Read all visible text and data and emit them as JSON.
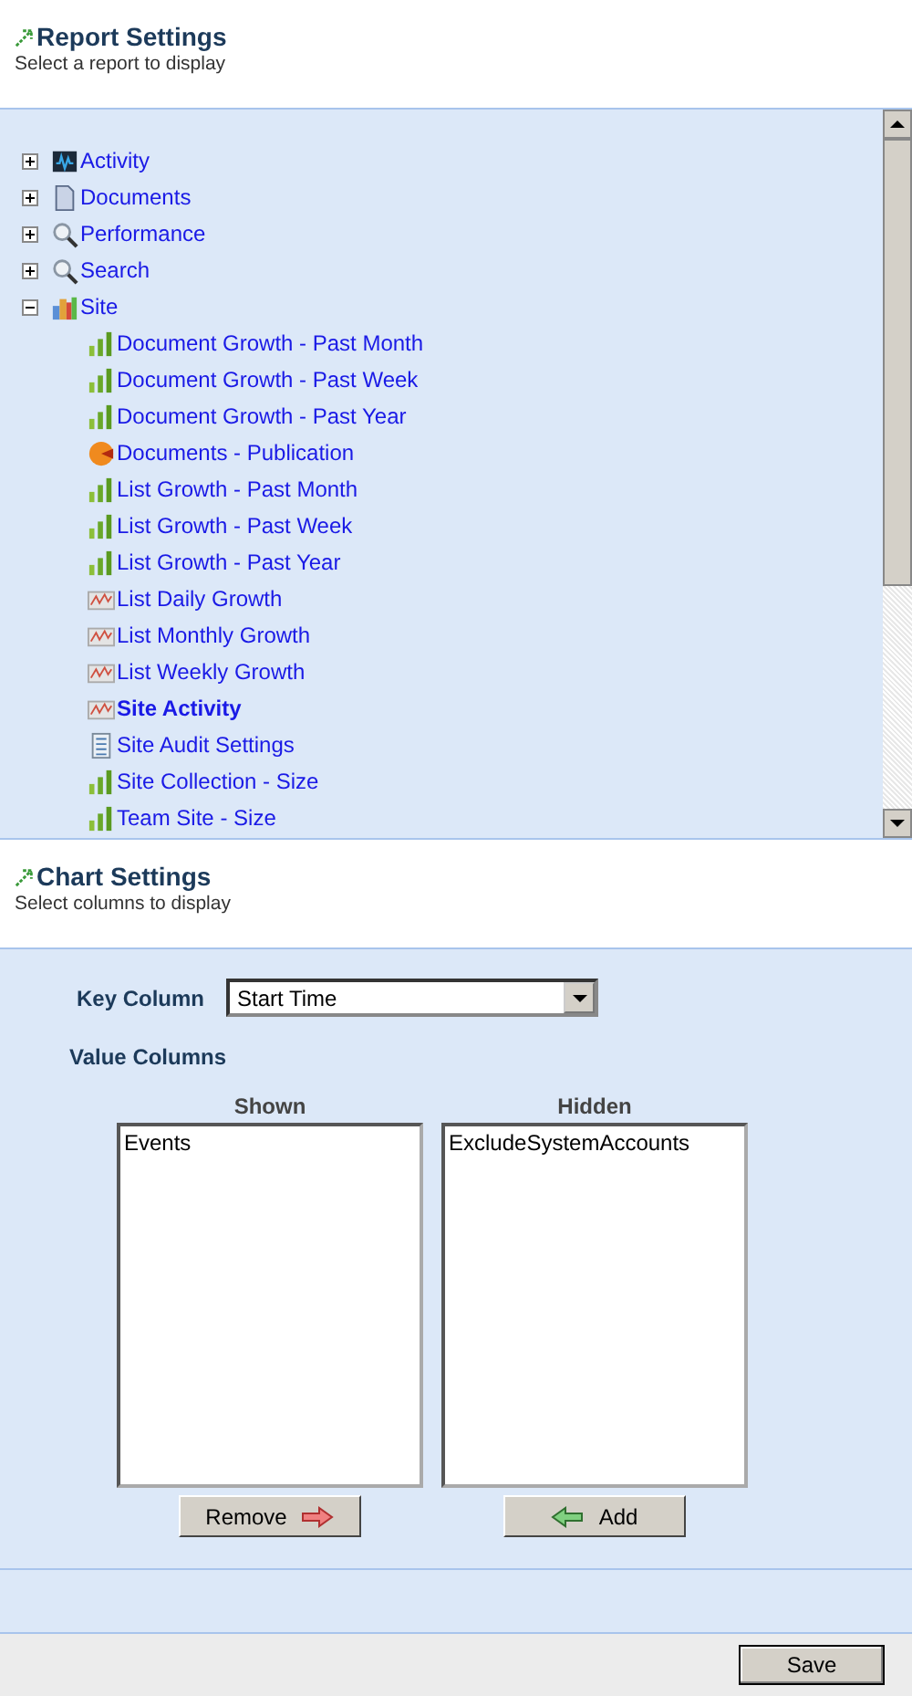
{
  "report_settings": {
    "title": "Report Settings",
    "subtitle": "Select a report to display"
  },
  "tree": [
    {
      "label": "Activity",
      "kind": "monitor",
      "expanded": false,
      "selected": false
    },
    {
      "label": "Documents",
      "kind": "document",
      "expanded": false,
      "selected": false
    },
    {
      "label": "Performance",
      "kind": "magnifier",
      "expanded": false,
      "selected": false
    },
    {
      "label": "Search",
      "kind": "magnifier",
      "expanded": false,
      "selected": false
    },
    {
      "label": "Site",
      "kind": "blocks",
      "expanded": true,
      "selected": false,
      "children": [
        {
          "label": "Document Growth - Past Month",
          "kind": "bar",
          "selected": false
        },
        {
          "label": "Document Growth - Past Week",
          "kind": "bar",
          "selected": false
        },
        {
          "label": "Document Growth - Past Year",
          "kind": "bar",
          "selected": false
        },
        {
          "label": "Documents - Publication",
          "kind": "pie",
          "selected": false
        },
        {
          "label": "List Growth - Past Month",
          "kind": "bar",
          "selected": false
        },
        {
          "label": "List Growth - Past Week",
          "kind": "bar",
          "selected": false
        },
        {
          "label": "List Growth - Past Year",
          "kind": "bar",
          "selected": false
        },
        {
          "label": "List Daily Growth",
          "kind": "line",
          "selected": false
        },
        {
          "label": "List Monthly Growth",
          "kind": "line",
          "selected": false
        },
        {
          "label": "List Weekly Growth",
          "kind": "line",
          "selected": false
        },
        {
          "label": "Site Activity",
          "kind": "line",
          "selected": true
        },
        {
          "label": "Site Audit Settings",
          "kind": "list",
          "selected": false
        },
        {
          "label": "Site Collection - Size",
          "kind": "bar",
          "selected": false
        },
        {
          "label": "Team Site - Size",
          "kind": "bar",
          "selected": false
        }
      ]
    }
  ],
  "chart_settings": {
    "title": "Chart Settings",
    "subtitle": "Select columns to display"
  },
  "key_column": {
    "label": "Key Column",
    "value": "Start Time"
  },
  "value_columns": {
    "label": "Value Columns",
    "shown": {
      "heading": "Shown",
      "items": [
        "Events"
      ]
    },
    "hidden": {
      "heading": "Hidden",
      "items": [
        "ExcludeSystemAccounts"
      ]
    }
  },
  "remove_button": "Remove",
  "add_button": "Add",
  "save_button": "Save"
}
